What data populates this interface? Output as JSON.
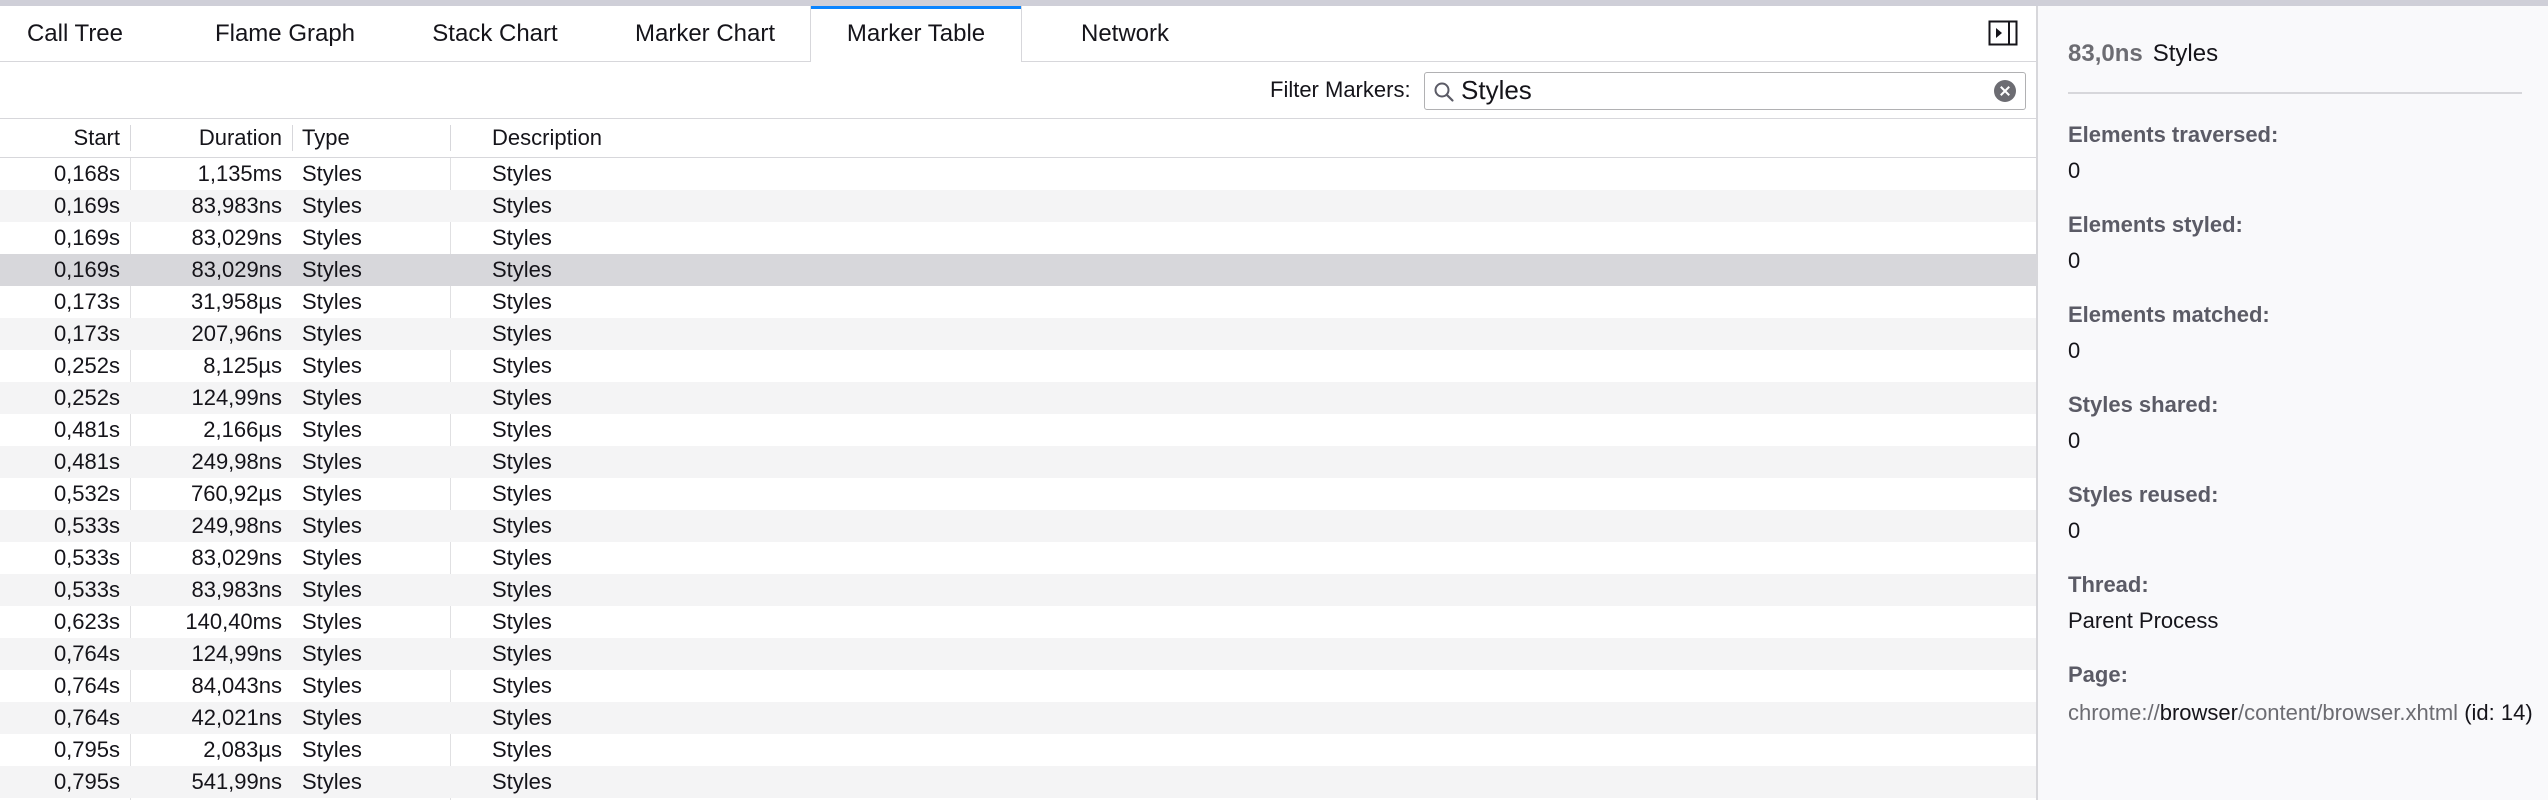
{
  "tabs": [
    {
      "label": "Call Tree"
    },
    {
      "label": "Flame Graph"
    },
    {
      "label": "Stack Chart"
    },
    {
      "label": "Marker Chart"
    },
    {
      "label": "Marker Table"
    },
    {
      "label": "Network"
    }
  ],
  "selected_tab": "Marker Table",
  "filter": {
    "label": "Filter Markers:",
    "value": "Styles"
  },
  "columns": {
    "start": "Start",
    "duration": "Duration",
    "type": "Type",
    "description": "Description"
  },
  "rows": [
    {
      "start": "0,168s",
      "duration": "1,135ms",
      "type": "Styles",
      "description": "Styles"
    },
    {
      "start": "0,169s",
      "duration": "83,983ns",
      "type": "Styles",
      "description": "Styles"
    },
    {
      "start": "0,169s",
      "duration": "83,029ns",
      "type": "Styles",
      "description": "Styles"
    },
    {
      "start": "0,169s",
      "duration": "83,029ns",
      "type": "Styles",
      "description": "Styles",
      "selected": true
    },
    {
      "start": "0,173s",
      "duration": "31,958µs",
      "type": "Styles",
      "description": "Styles"
    },
    {
      "start": "0,173s",
      "duration": "207,96ns",
      "type": "Styles",
      "description": "Styles"
    },
    {
      "start": "0,252s",
      "duration": "8,125µs",
      "type": "Styles",
      "description": "Styles"
    },
    {
      "start": "0,252s",
      "duration": "124,99ns",
      "type": "Styles",
      "description": "Styles"
    },
    {
      "start": "0,481s",
      "duration": "2,166µs",
      "type": "Styles",
      "description": "Styles"
    },
    {
      "start": "0,481s",
      "duration": "249,98ns",
      "type": "Styles",
      "description": "Styles"
    },
    {
      "start": "0,532s",
      "duration": "760,92µs",
      "type": "Styles",
      "description": "Styles"
    },
    {
      "start": "0,533s",
      "duration": "249,98ns",
      "type": "Styles",
      "description": "Styles"
    },
    {
      "start": "0,533s",
      "duration": "83,029ns",
      "type": "Styles",
      "description": "Styles"
    },
    {
      "start": "0,533s",
      "duration": "83,983ns",
      "type": "Styles",
      "description": "Styles"
    },
    {
      "start": "0,623s",
      "duration": "140,40ms",
      "type": "Styles",
      "description": "Styles"
    },
    {
      "start": "0,764s",
      "duration": "124,99ns",
      "type": "Styles",
      "description": "Styles"
    },
    {
      "start": "0,764s",
      "duration": "84,043ns",
      "type": "Styles",
      "description": "Styles"
    },
    {
      "start": "0,764s",
      "duration": "42,021ns",
      "type": "Styles",
      "description": "Styles"
    },
    {
      "start": "0,795s",
      "duration": "2,083µs",
      "type": "Styles",
      "description": "Styles"
    },
    {
      "start": "0,795s",
      "duration": "541,99ns",
      "type": "Styles",
      "description": "Styles"
    }
  ],
  "sidebar": {
    "duration": "83,0ns",
    "name": "Styles",
    "fields": [
      {
        "label": "Elements traversed:",
        "value": "0"
      },
      {
        "label": "Elements styled:",
        "value": "0"
      },
      {
        "label": "Elements matched:",
        "value": "0"
      },
      {
        "label": "Styles shared:",
        "value": "0"
      },
      {
        "label": "Styles reused:",
        "value": "0"
      },
      {
        "label": "Thread:",
        "value": "Parent Process"
      }
    ],
    "page": {
      "label": "Page:",
      "url_scheme": "chrome://",
      "url_host": "browser",
      "url_path": "/content/browser.xhtml",
      "id_text": "(id: 14)"
    }
  },
  "colors": {
    "accent": "#0a84ff",
    "selected_row": "#d7d7db",
    "odd_row": "#f4f4f5"
  }
}
